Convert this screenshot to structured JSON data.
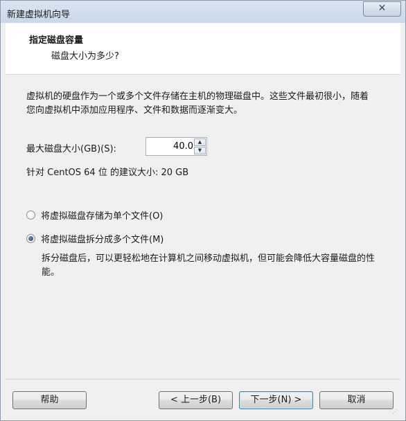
{
  "window": {
    "title": "新建虚拟机向导",
    "close_glyph": "✕"
  },
  "header": {
    "title": "指定磁盘容量",
    "subtitle": "磁盘大小为多少?"
  },
  "content": {
    "description": "虚拟机的硬盘作为一个或多个文件存储在主机的物理磁盘中。这些文件最初很小，随着您向虚拟机中添加应用程序、文件和数据而逐渐变大。",
    "disk_size_label": "最大磁盘大小(GB)(S):",
    "disk_size_value": "40.0",
    "recommendation": "针对 CentOS 64 位 的建议大小: 20 GB",
    "options": [
      {
        "label": "将虚拟磁盘存储为单个文件(O)",
        "selected": false
      },
      {
        "label": "将虚拟磁盘拆分成多个文件(M)",
        "selected": true
      }
    ],
    "split_note": "拆分磁盘后，可以更轻松地在计算机之间移动虚拟机，但可能会降低大容量磁盘的性能。"
  },
  "footer": {
    "help_label": "帮助",
    "back_label": "< 上一步(B)",
    "next_label": "下一步(N) >",
    "cancel_label": "取消"
  }
}
